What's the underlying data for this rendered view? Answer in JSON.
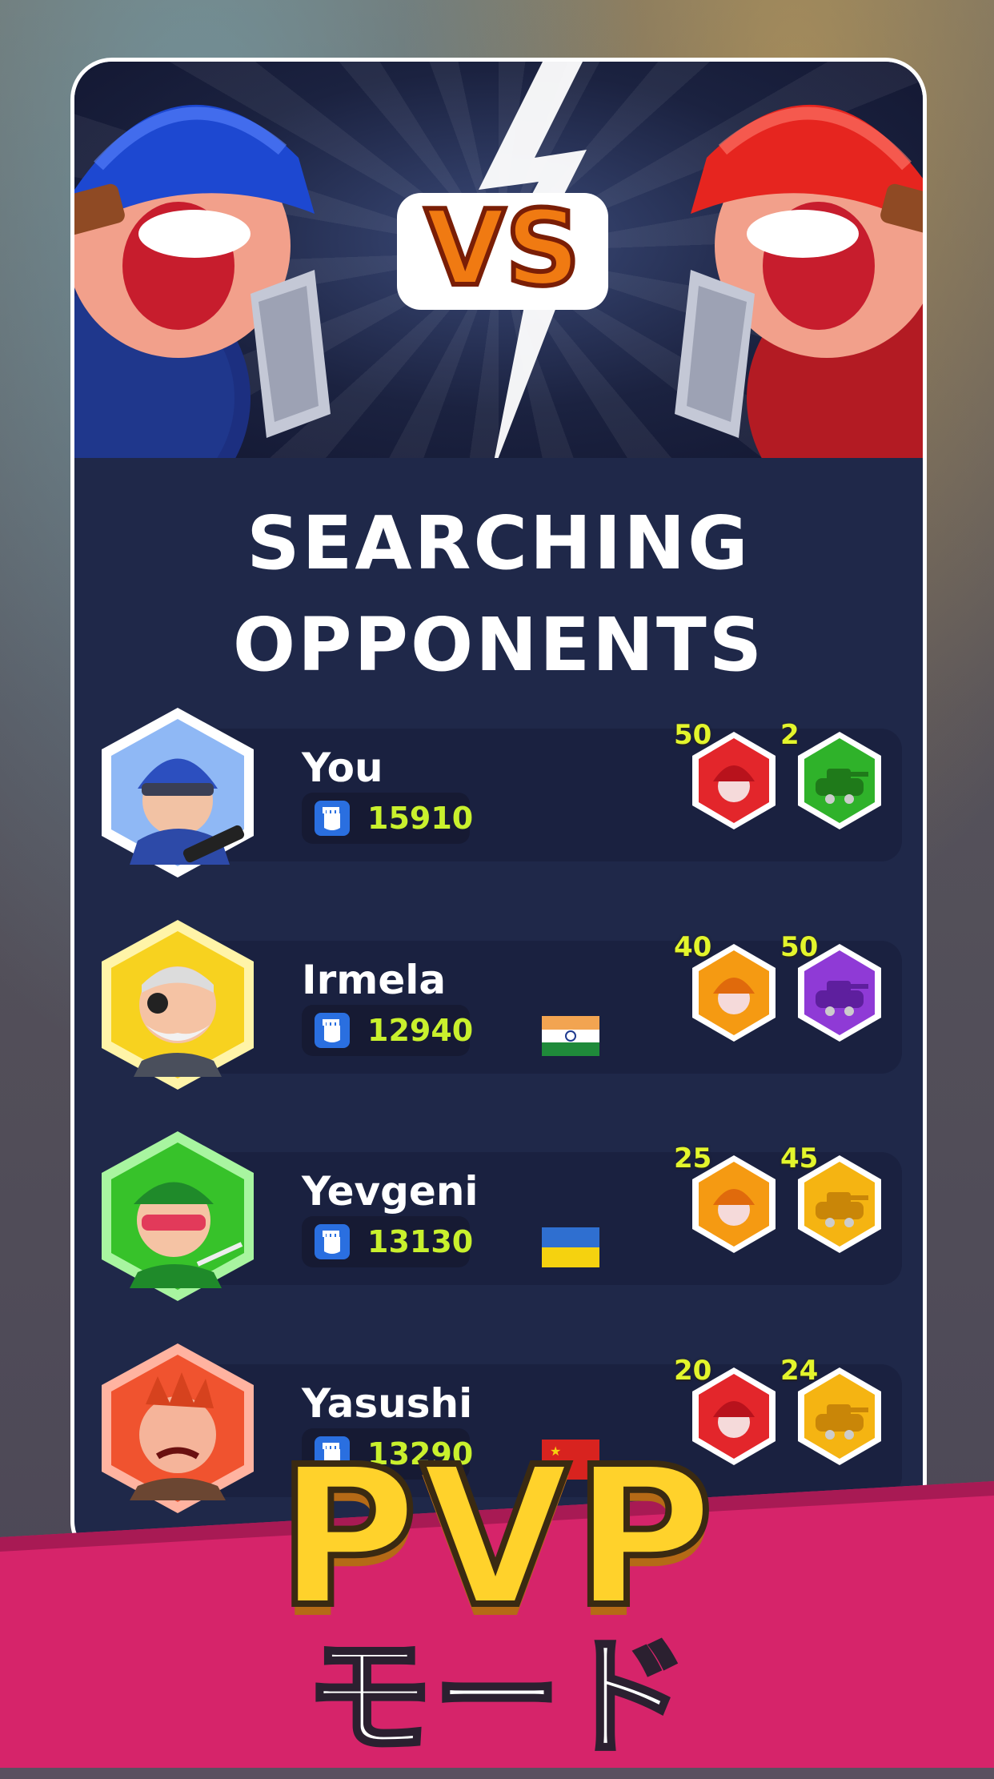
{
  "header": {
    "vs_label": "VS",
    "title_line1": "SEARCHING",
    "title_line2": "OPPONENTS"
  },
  "players": [
    {
      "name": "You",
      "score": "15910",
      "flag": "",
      "avatar_color": "#5ea8ef",
      "units": [
        {
          "level": "50",
          "color": "#e3262b",
          "kind": "soldier-icon"
        },
        {
          "level": "2",
          "color": "#2fb22a",
          "kind": "tank-icon"
        }
      ]
    },
    {
      "name": "Irmela",
      "score": "12940",
      "flag": "india-flag",
      "avatar_color": "#f7d21f",
      "units": [
        {
          "level": "40",
          "color": "#f59a12",
          "kind": "soldier-icon"
        },
        {
          "level": "50",
          "color": "#8f3ad6",
          "kind": "tank-icon"
        }
      ]
    },
    {
      "name": "Yevgeni",
      "score": "13130",
      "flag": "ukraine-flag",
      "avatar_color": "#37c22a",
      "units": [
        {
          "level": "25",
          "color": "#f59a12",
          "kind": "soldier-icon"
        },
        {
          "level": "45",
          "color": "#f5b412",
          "kind": "tank-icon"
        }
      ]
    },
    {
      "name": "Yasushi",
      "score": "13290",
      "flag": "china-flag",
      "avatar_color": "#f0532f",
      "units": [
        {
          "level": "20",
          "color": "#e3262b",
          "kind": "soldier-icon"
        },
        {
          "level": "24",
          "color": "#f5b412",
          "kind": "tank-icon"
        }
      ]
    }
  ],
  "promo": {
    "title": "PVP",
    "subtitle": "モード"
  },
  "colors": {
    "accent_score": "#c9f02d",
    "banner_pink": "#d6246a"
  }
}
